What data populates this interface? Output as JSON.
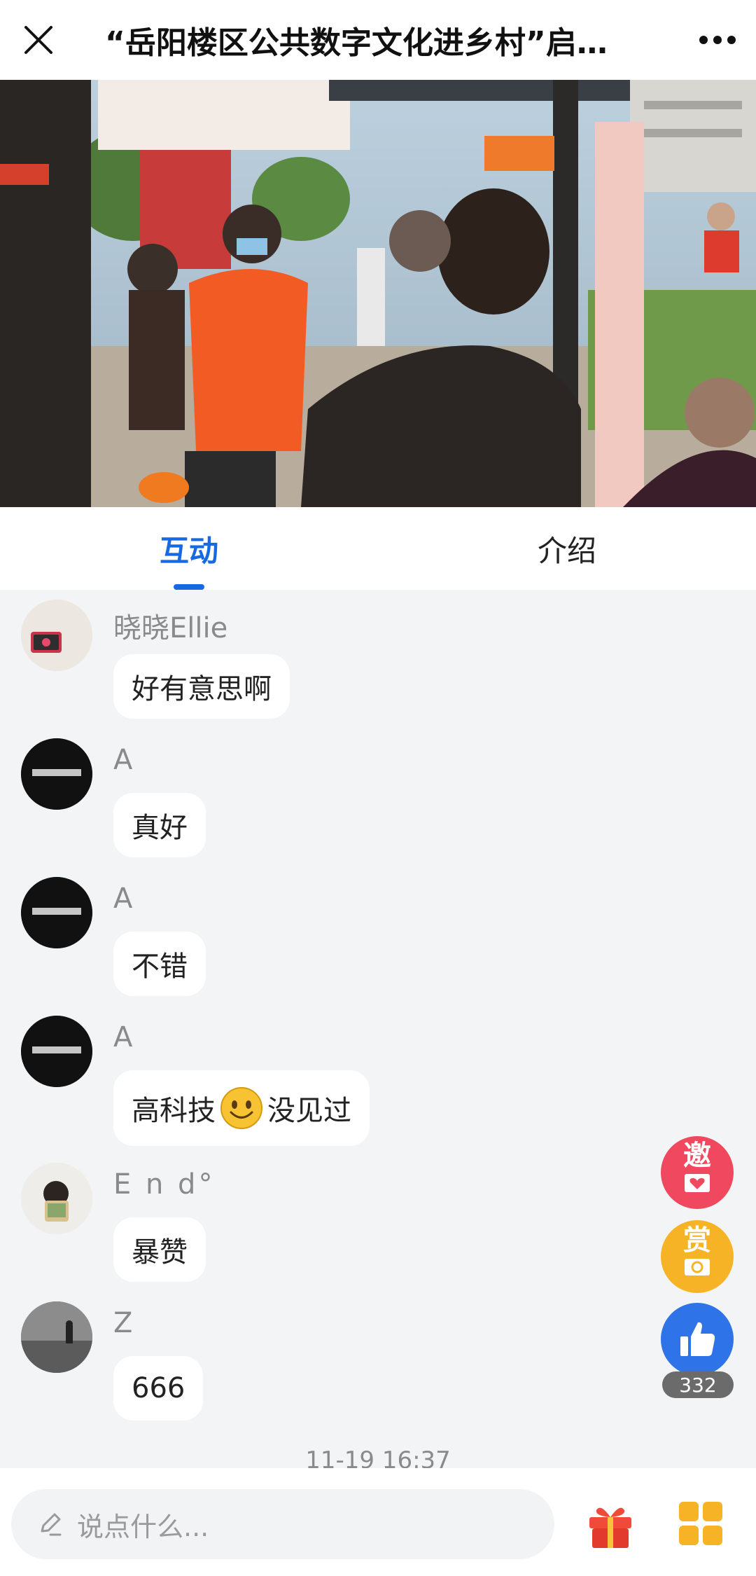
{
  "header": {
    "title": "“岳阳楼区公共数字文化进乡村”启…"
  },
  "tabs": [
    {
      "label": "互动",
      "active": true
    },
    {
      "label": "介绍",
      "active": false
    }
  ],
  "messages": [
    {
      "user": "晓晓Ellie",
      "text": "好有意思啊"
    },
    {
      "user": "A",
      "text": "真好"
    },
    {
      "user": "A",
      "text": "不错"
    },
    {
      "user": "A",
      "text_before": "高科技",
      "text_after": "没见过",
      "emoji": "smiley-emoji"
    },
    {
      "user": "E n d°",
      "text": "暴赞"
    },
    {
      "user": "Z",
      "text": "666"
    }
  ],
  "timestamp": "11-19 16:37",
  "floating": {
    "invite_label": "邀",
    "reward_label": "赏",
    "like_count": "332"
  },
  "composer": {
    "placeholder": "说点什么..."
  },
  "colors": {
    "accent": "#1769e0",
    "invite": "#f0485e",
    "reward": "#f6b325",
    "like": "#2f73e8"
  },
  "icons": [
    "close-icon",
    "more-icon",
    "pencil-icon",
    "gift-icon",
    "apps-grid-icon",
    "thumbs-up-icon",
    "heart-icon"
  ]
}
